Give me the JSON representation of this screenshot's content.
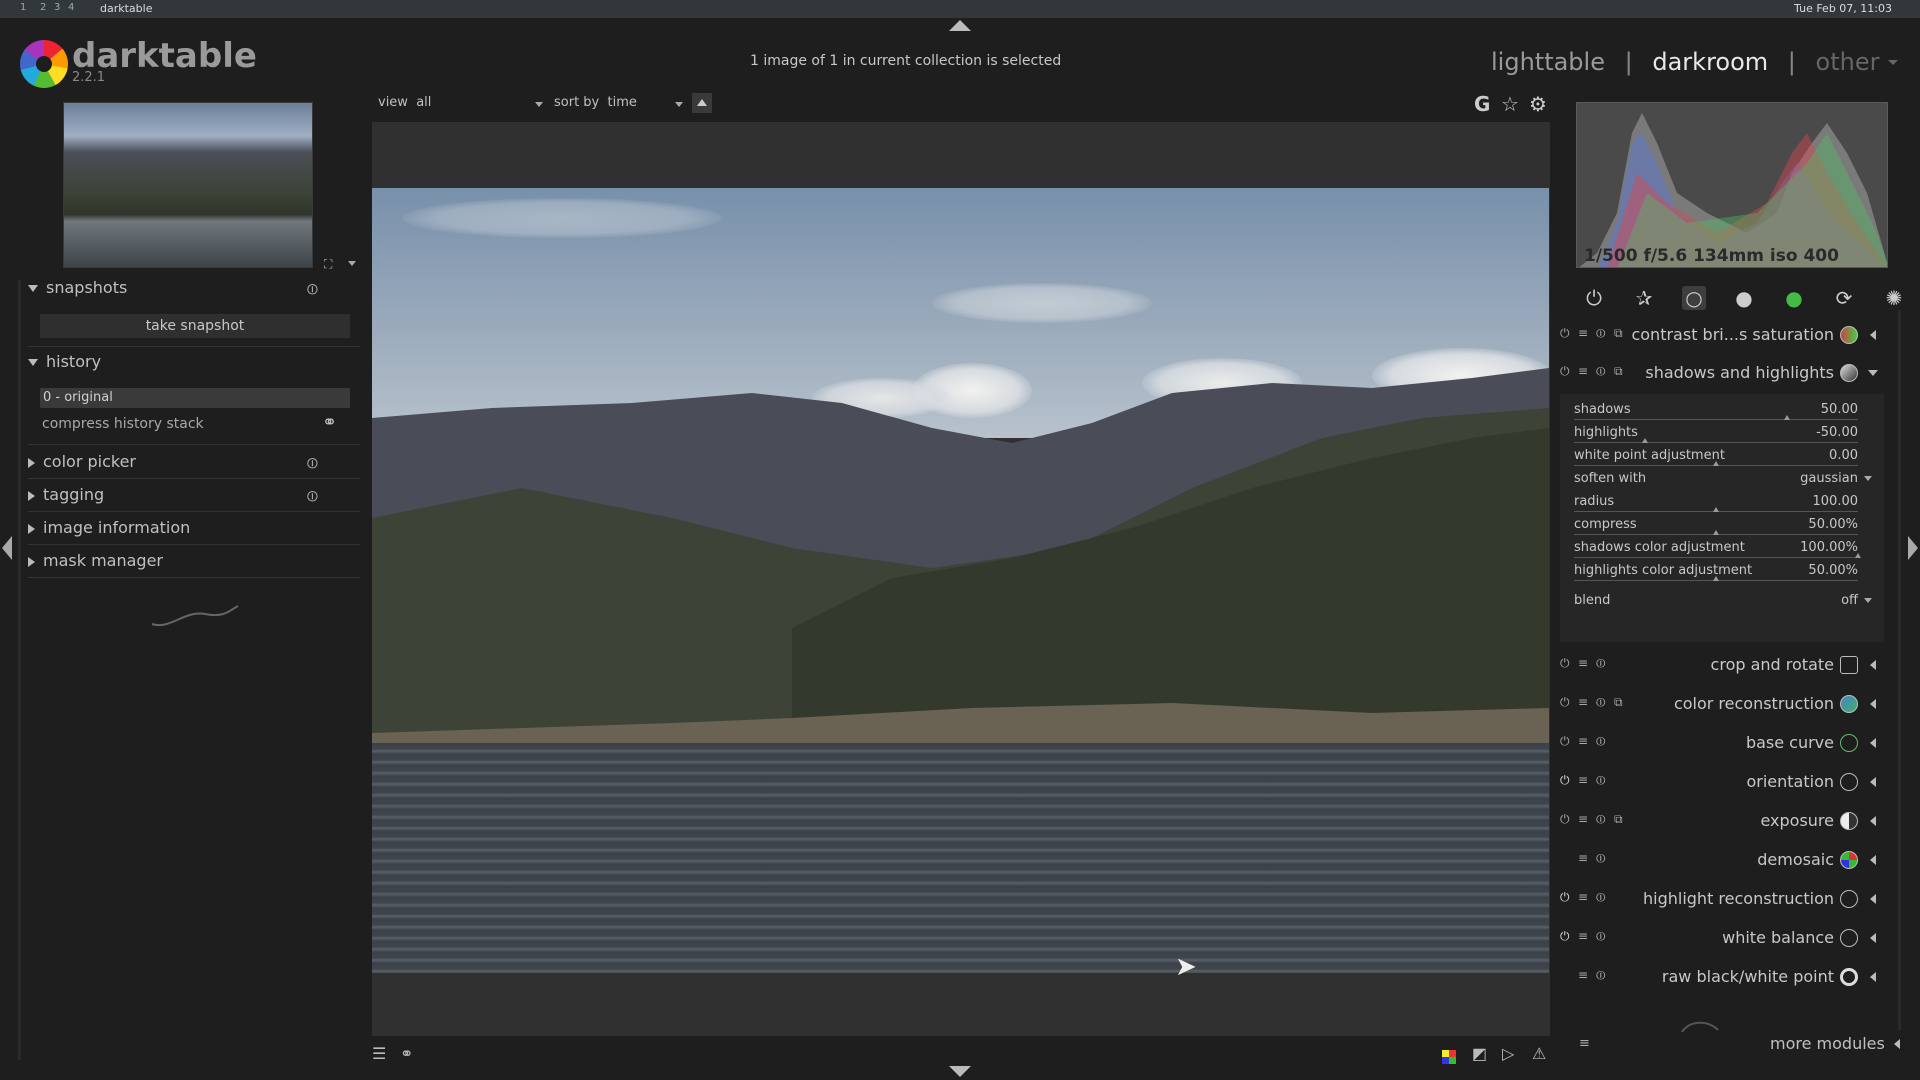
{
  "system_bar": {
    "workspaces": [
      "1",
      "2",
      "3",
      "4"
    ],
    "app_name": "darktable",
    "clock": "Tue Feb 07, 11:03"
  },
  "header": {
    "app_title": "darktable",
    "version": "2.2.1",
    "status": "1 image of 1 in current collection is selected",
    "views": {
      "lighttable": "lighttable",
      "darkroom": "darkroom",
      "other": "other",
      "separator": "|"
    }
  },
  "toolbar": {
    "view_label": "view",
    "view_value": "all",
    "sort_label": "sort by",
    "sort_value": "time",
    "grouping_label": "G"
  },
  "left_panel": {
    "snapshots": {
      "title": "snapshots",
      "take_snapshot": "take snapshot"
    },
    "history": {
      "title": "history",
      "items": [
        "0 - original"
      ],
      "compress": "compress history stack"
    },
    "sections": [
      {
        "title": "color picker"
      },
      {
        "title": "tagging"
      },
      {
        "title": "image information"
      },
      {
        "title": "mask manager"
      }
    ]
  },
  "right_panel": {
    "exif": "1/500 f/5.6 134mm iso 400",
    "modules_top": [
      {
        "name": "contrast bri...s saturation"
      },
      {
        "name": "shadows and highlights"
      }
    ],
    "shadows_highlights": {
      "sliders": [
        {
          "label": "shadows",
          "value": "50.00",
          "level": 0.75
        },
        {
          "label": "highlights",
          "value": "-50.00",
          "level": 0.25
        },
        {
          "label": "white point adjustment",
          "value": "0.00",
          "level": 0.5
        },
        {
          "label": "soften with",
          "value": "gaussian"
        },
        {
          "label": "radius",
          "value": "100.00",
          "level": 0.5
        },
        {
          "label": "compress",
          "value": "50.00%",
          "level": 0.5
        },
        {
          "label": "shadows color adjustment",
          "value": "100.00%",
          "level": 1.0
        },
        {
          "label": "highlights color adjustment",
          "value": "50.00%",
          "level": 0.5
        }
      ],
      "blend": {
        "label": "blend",
        "value": "off"
      }
    },
    "modules": [
      {
        "name": "crop and rotate"
      },
      {
        "name": "color reconstruction"
      },
      {
        "name": "base curve"
      },
      {
        "name": "orientation"
      },
      {
        "name": "exposure"
      },
      {
        "name": "demosaic"
      },
      {
        "name": "highlight reconstruction"
      },
      {
        "name": "white balance"
      },
      {
        "name": "raw black/white point"
      }
    ],
    "more_modules": "more modules"
  },
  "colors": {
    "background": "#1e1e1e",
    "panel": "#262626",
    "text": "#c8c8c8",
    "active_view": "#e8e8e8"
  }
}
